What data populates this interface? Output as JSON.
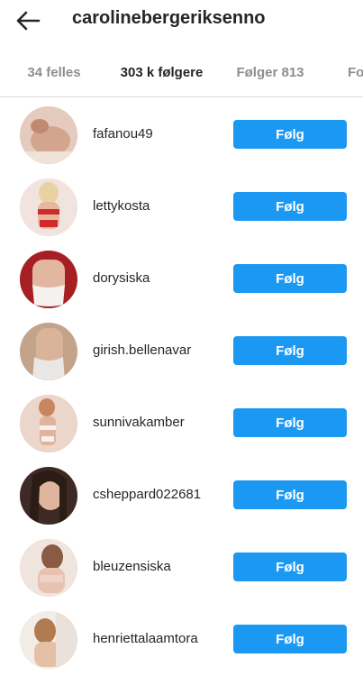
{
  "header": {
    "title": "carolinebergeriksenno",
    "back_icon": "arrow-left-icon"
  },
  "tabs": [
    {
      "label": "34 felles",
      "active": false
    },
    {
      "label": "303 k følgere",
      "active": true
    },
    {
      "label": "Følger 813",
      "active": false
    },
    {
      "label": "Fo",
      "active": false
    }
  ],
  "followers": [
    {
      "username": "fafanou49",
      "button": "Følg",
      "avatar_color": "#d9b8a6"
    },
    {
      "username": "lettykosta",
      "button": "Følg",
      "avatar_color": "#d45a5a"
    },
    {
      "username": "dorysiska",
      "button": "Følg",
      "avatar_color": "#b32b2b"
    },
    {
      "username": "girish.bellenavar",
      "button": "Følg",
      "avatar_color": "#c9a58d"
    },
    {
      "username": "sunnivakamber",
      "button": "Følg",
      "avatar_color": "#e6c3b7"
    },
    {
      "username": "csheppard022681",
      "button": "Følg",
      "avatar_color": "#6b4335"
    },
    {
      "username": "bleuzensiska",
      "button": "Følg",
      "avatar_color": "#e8cfc6"
    },
    {
      "username": "henriettalaamtora",
      "button": "Følg",
      "avatar_color": "#c7a07a"
    }
  ],
  "colors": {
    "follow_button": "#1a98f2",
    "text_primary": "#262626",
    "text_secondary": "#8e8e8e",
    "divider": "#dbdbdb"
  }
}
